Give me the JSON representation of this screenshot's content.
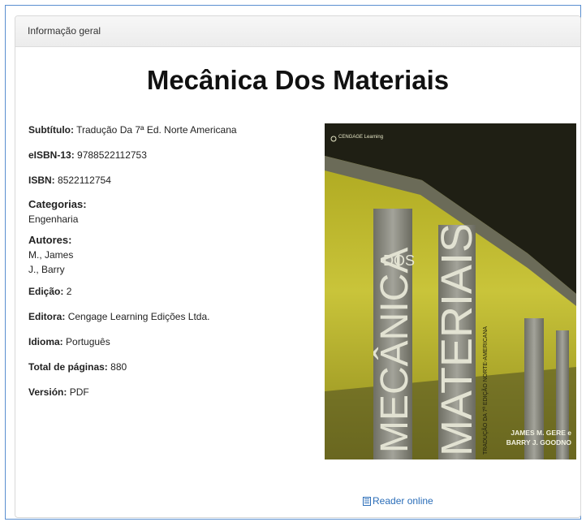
{
  "panel": {
    "header_title": "Informação geral"
  },
  "book": {
    "title": "Mecânica Dos Materiais",
    "subtitle": {
      "label": "Subtítulo:",
      "value": "Tradução Da 7ª Ed. Norte Americana"
    },
    "eisbn": {
      "label": "eISBN-13:",
      "value": "9788522112753"
    },
    "isbn": {
      "label": "ISBN:",
      "value": "8522112754"
    },
    "categories": {
      "label": "Categorias:",
      "items": [
        "Engenharia"
      ]
    },
    "authors": {
      "label": "Autores:",
      "items": [
        "M., James",
        "J., Barry"
      ]
    },
    "edition": {
      "label": "Edição:",
      "value": "2"
    },
    "publisher": {
      "label": "Editora:",
      "value": "Cengage Learning Edições Ltda."
    },
    "language": {
      "label": "Idioma:",
      "value": "Português"
    },
    "pages": {
      "label": "Total de páginas:",
      "value": "880"
    },
    "version": {
      "label": "Versión:",
      "value": "PDF"
    }
  },
  "cover": {
    "publisher_logo_text": "CENGAGE Learning",
    "word_dos": "DOS",
    "word_mecanica": "MECÂNICA",
    "word_materiais": "MATERIAIS",
    "side_text": "TRADUÇÃO DA 7ª EDIÇÃO NORTE-AMERICANA",
    "author_line_1": "JAMES M. GERE e",
    "author_line_2": "BARRY J. GOODNO",
    "colors": {
      "sky": "#c4c02a",
      "concrete": "#8f8f86",
      "dark": "#1f1f14"
    }
  },
  "reader_link": {
    "label": "Reader online",
    "icon": "book-icon"
  }
}
